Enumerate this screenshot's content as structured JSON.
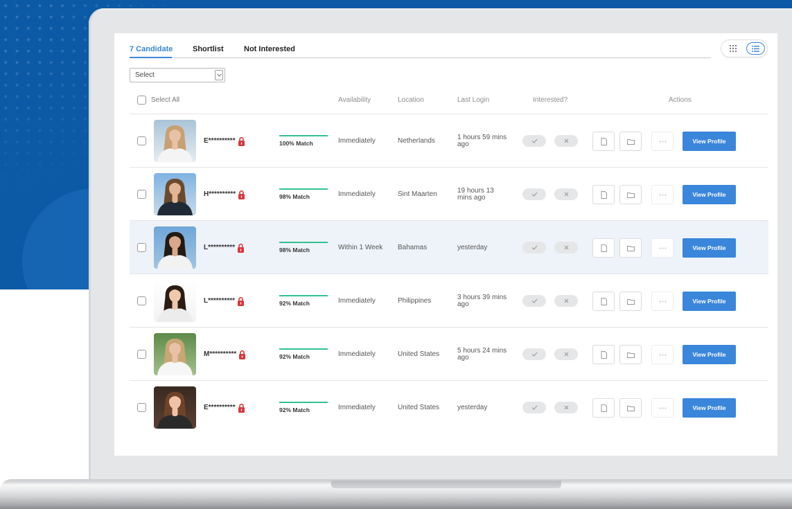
{
  "colors": {
    "brand_blue": "#0c5aa6",
    "accent": "#3a86da",
    "match_green": "#33c08f",
    "lock_red": "#d6383f"
  },
  "tabs": [
    {
      "label": "7 Candidate"
    },
    {
      "label": "Shortlist"
    },
    {
      "label": "Not Interested"
    }
  ],
  "filter": {
    "selected": "Select"
  },
  "table_header": {
    "select_all": "Select All",
    "availability": "Availability",
    "location": "Location",
    "last_login": "Last Login",
    "interested": "Interested?",
    "actions": "Actions"
  },
  "actions": {
    "view_profile": "View Profile"
  },
  "candidates": [
    {
      "name": "E**********",
      "match": "100% Match",
      "availability": "Immediately",
      "location": "Netherlands",
      "last_login": "1 hours 59 mins ago",
      "photo": {
        "bg_top": "#a9c4d8",
        "bg_bottom": "#e6ecf0",
        "hair": "#c7a173",
        "skin": "#e8c2a8",
        "clothing": "#f4f4f4"
      }
    },
    {
      "name": "H**********",
      "match": "98% Match",
      "availability": "Immediately",
      "location": "Sint Maarten",
      "last_login": "19 hours 13 mins ago",
      "photo": {
        "bg_top": "#7fb3e3",
        "bg_bottom": "#c9d9e6",
        "hair": "#6b4a2e",
        "skin": "#e2b597",
        "clothing": "#1f2a36"
      }
    },
    {
      "name": "L**********",
      "match": "98% Match",
      "availability": "Within 1 Week",
      "location": "Bahamas",
      "last_login": "yesterday",
      "photo": {
        "bg_top": "#6fa6d9",
        "bg_bottom": "#a3c4df",
        "hair": "#231a14",
        "skin": "#d9a88a",
        "clothing": "#f2f2f2"
      }
    },
    {
      "name": "L**********",
      "match": "92% Match",
      "availability": "Immediately",
      "location": "Philippines",
      "last_login": "3 hours 39 mins ago",
      "photo": {
        "bg_top": "#ffffff",
        "bg_bottom": "#f3f3f3",
        "hair": "#2b1d15",
        "skin": "#f0c9ad",
        "clothing": "#ececec"
      }
    },
    {
      "name": "M**********",
      "match": "92% Match",
      "availability": "Immediately",
      "location": "United States",
      "last_login": "5 hours 24 mins ago",
      "photo": {
        "bg_top": "#5e8a4a",
        "bg_bottom": "#a4c08a",
        "hair": "#c9a775",
        "skin": "#e8c1a6",
        "clothing": "#f6f6f6"
      }
    },
    {
      "name": "E**********",
      "match": "92% Match",
      "availability": "Immediately",
      "location": "United States",
      "last_login": "yesterday",
      "photo": {
        "bg_top": "#3a2a22",
        "bg_bottom": "#5a3f31",
        "hair": "#6e4329",
        "skin": "#eec3a8",
        "clothing": "#2a2a2a"
      }
    }
  ]
}
